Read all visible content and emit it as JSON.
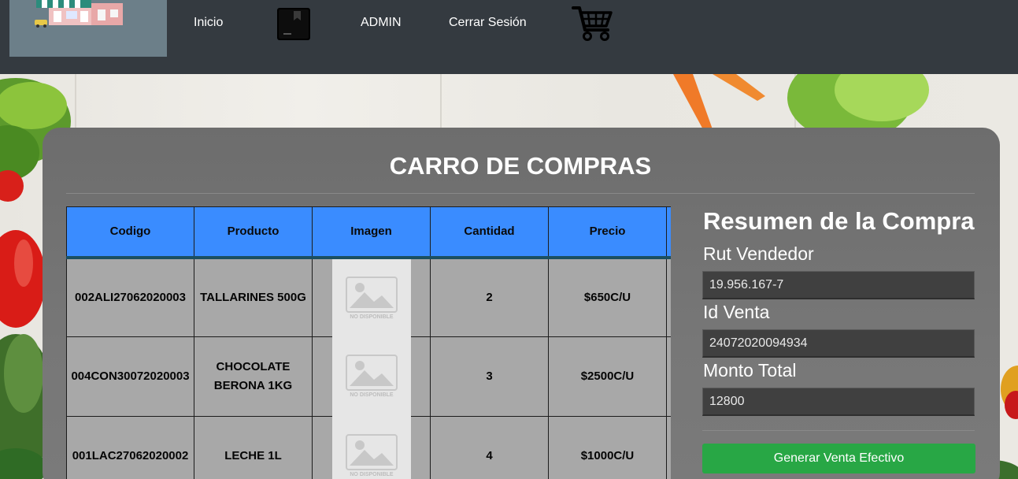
{
  "navbar": {
    "links": {
      "inicio": "Inicio",
      "admin": "ADMIN",
      "logout": "Cerrar Sesión"
    },
    "icons": [
      "store-logo",
      "bookmark-icon",
      "shopping-cart-icon"
    ]
  },
  "page": {
    "title": "CARRO DE COMPRAS"
  },
  "cart_table": {
    "headers": [
      "Codigo",
      "Producto",
      "Imagen",
      "Cantidad",
      "Precio"
    ],
    "rows": [
      {
        "codigo": "002ALI27062020003",
        "producto": "TALLARINES 500G",
        "imagen": "NO DISPONIBLE",
        "cantidad": "2",
        "precio": "$650C/U"
      },
      {
        "codigo": "004CON30072020003",
        "producto": "CHOCOLATE BERONA 1KG",
        "imagen": "NO DISPONIBLE",
        "cantidad": "3",
        "precio": "$2500C/U"
      },
      {
        "codigo": "001LAC27062020002",
        "producto": "LECHE 1L",
        "imagen": "NO DISPONIBLE",
        "cantidad": "4",
        "precio": "$1000C/U"
      }
    ]
  },
  "summary": {
    "title": "Resumen de la Compra",
    "rut_label": "Rut Vendedor",
    "rut_value": "19.956.167-7",
    "id_label": "Id Venta",
    "id_value": "24072020094934",
    "total_label": "Monto Total",
    "total_value": "12800",
    "button_label": "Generar Venta Efectivo"
  },
  "colors": {
    "navbar_bg": "#343a40",
    "table_header": "#3a8cff",
    "button_green": "#28a745",
    "panel_bg": "#707070"
  }
}
